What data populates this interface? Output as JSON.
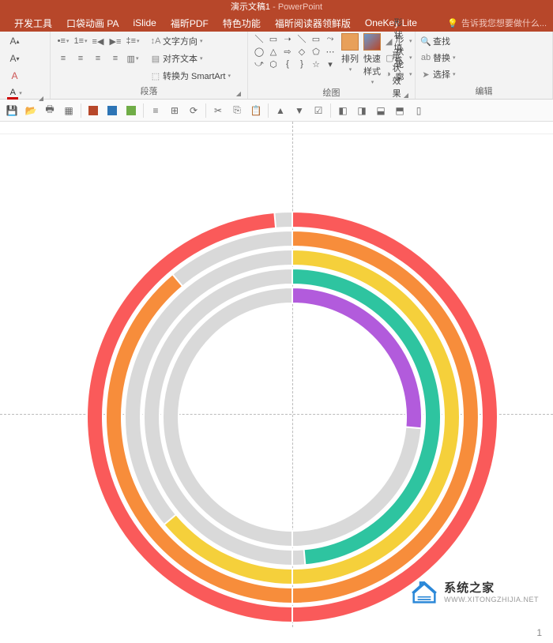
{
  "title": {
    "doc": "演示文稿1",
    "app": "PowerPoint"
  },
  "tabs": [
    "开发工具",
    "口袋动画 PA",
    "iSlide",
    "福昕PDF",
    "特色功能",
    "福昕阅读器领鲜版",
    "OneKey Lite"
  ],
  "tell_me": "告诉我您想要做什么...",
  "font": {
    "inc": "A",
    "dec": "A",
    "clear": "A",
    "color_dd": "▾"
  },
  "para": {
    "bullets": "≡",
    "numbering": "≡",
    "levels": "≡",
    "indent_dec": "≡",
    "indent_inc": "≡",
    "align_l": "≡",
    "align_c": "≡",
    "align_r": "≡",
    "align_j": "≡",
    "cols": "▥",
    "text_dir": "文字方向",
    "align_text": "对齐文本",
    "smartart": "转换为 SmartArt",
    "label": "段落"
  },
  "draw": {
    "arrange": "排列",
    "quick": "快速样式",
    "fill": "形状填充",
    "outline": "形状轮廓",
    "effects": "形状效果",
    "label": "绘图"
  },
  "edit": {
    "find": "查找",
    "replace": "替换",
    "select": "选择",
    "label": "编辑"
  },
  "qat_colors": [
    "#b7472a",
    "#2e75b6",
    "#70ad47"
  ],
  "watermark": {
    "name": "系统之家",
    "url": "WWW.XITONGZHIJIA.NET"
  },
  "page": "1",
  "chart_data": {
    "type": "doughnut-multi",
    "center": [
      260,
      260
    ],
    "rings": [
      {
        "r_outer": 260,
        "r_inner": 240,
        "color": "#fa5a5a",
        "start": 270,
        "sweep": 355
      },
      {
        "r_outer": 236,
        "r_inner": 216,
        "color": "#f78d3b",
        "start": 270,
        "sweep": 320
      },
      {
        "r_outer": 212,
        "r_inner": 192,
        "color": "#f5d03b",
        "start": 270,
        "sweep": 230
      },
      {
        "r_outer": 188,
        "r_inner": 168,
        "color": "#2ec4a0",
        "start": 270,
        "sweep": 175
      },
      {
        "r_outer": 164,
        "r_inner": 144,
        "color": "#b25bdc",
        "start": 270,
        "sweep": 95
      }
    ],
    "bg_ring_color": "#d9d9d9"
  }
}
